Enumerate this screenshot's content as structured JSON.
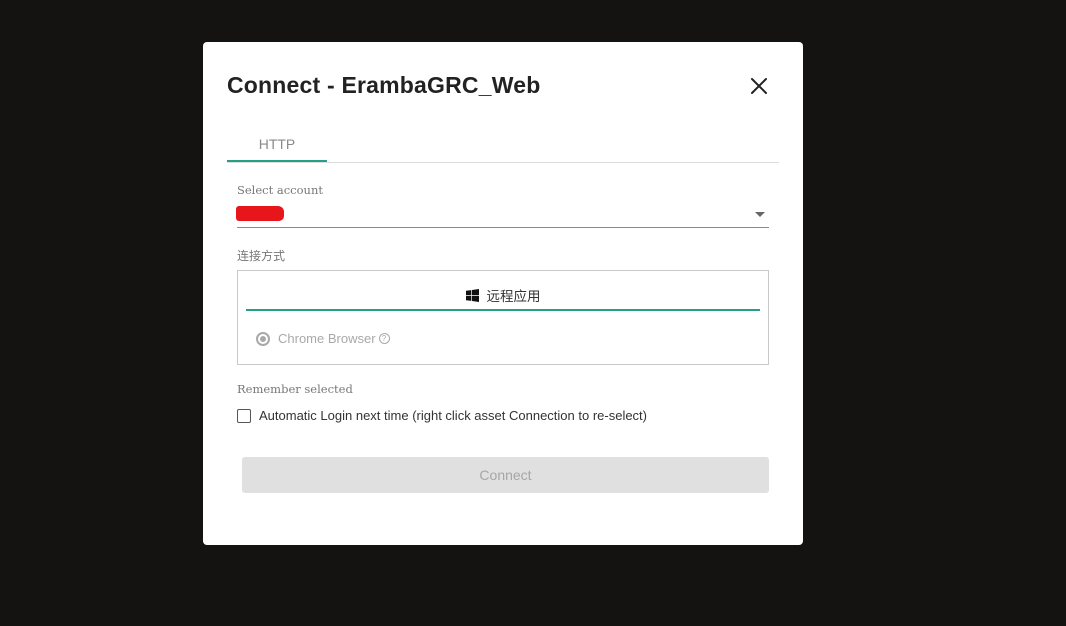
{
  "dialog": {
    "title": "Connect - ErambaGRC_Web",
    "tabs": [
      {
        "label": "HTTP",
        "active": true
      }
    ],
    "select_account": {
      "label": "Select account",
      "value": ""
    },
    "connection_method": {
      "label": "连接方式",
      "tab_label": "远程应用",
      "tab_icon": "windows-icon",
      "option_label": "Chrome Browser",
      "option_selected": true,
      "option_help": "?"
    },
    "remember": {
      "label": "Remember selected",
      "checkbox_label": "Automatic Login next time (right click asset Connection to re-select)",
      "checked": false
    },
    "connect_button": "Connect",
    "colors": {
      "accent": "#26a085",
      "overlay": "#141312",
      "redaction": "#e8161b",
      "button_disabled_bg": "#e0e0e0"
    }
  }
}
